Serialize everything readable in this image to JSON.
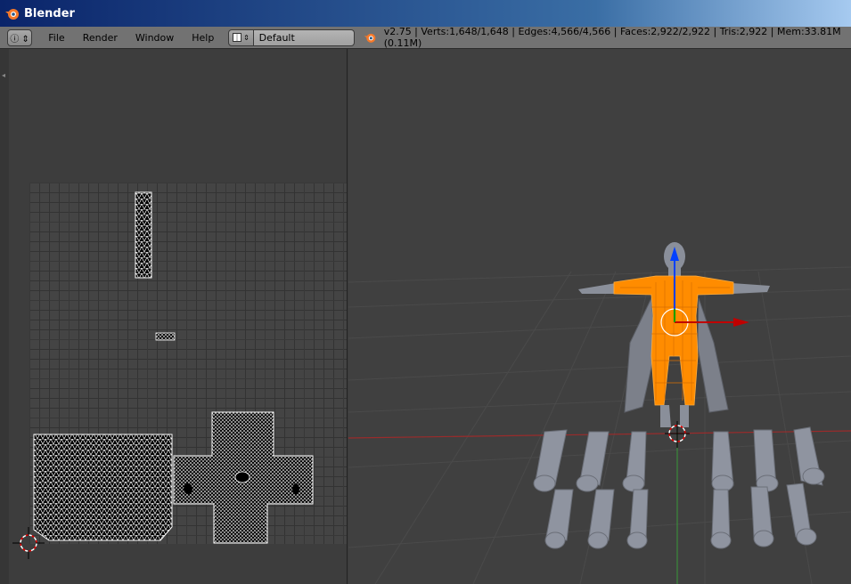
{
  "window": {
    "title": "Blender",
    "logo_icon": "blender-logo-icon"
  },
  "infobar": {
    "editor_type_icon": "info-icon",
    "menu": [
      "File",
      "Render",
      "Window",
      "Help"
    ],
    "screen_layout": "Default",
    "stats": "v2.75 | Verts:1,648/1,648 | Edges:4,566/4,566 | Faces:2,922/2,922 | Tris:2,922 | Mem:33.81M (0.11M)"
  },
  "colors": {
    "selected_mesh": "#ff8c00",
    "axis_x": "#c00000",
    "axis_y": "#00a000",
    "axis_z": "#0040ff",
    "mesh_gray": "#8a8f9a",
    "uv_islands": "#ffffff"
  }
}
